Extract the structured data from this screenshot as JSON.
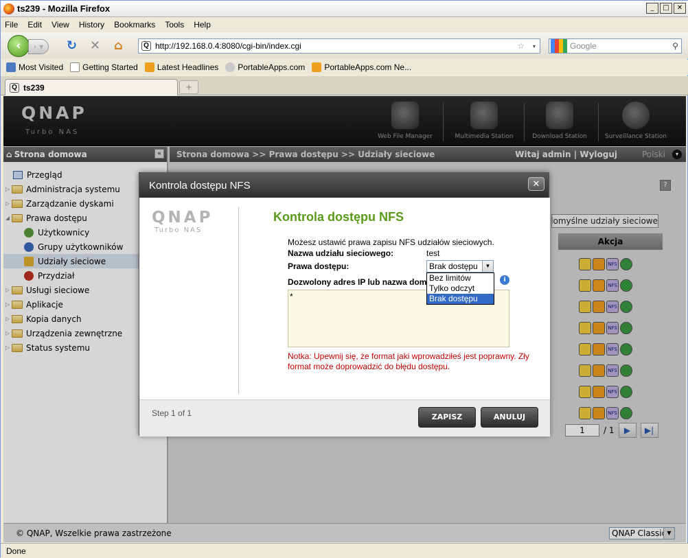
{
  "browser": {
    "title": "ts239 - Mozilla Firefox",
    "menus": [
      "File",
      "Edit",
      "View",
      "History",
      "Bookmarks",
      "Tools",
      "Help"
    ],
    "url": "http://192.168.0.4:8080/cgi-bin/index.cgi",
    "search_placeholder": "Google",
    "bookmarks": [
      "Most Visited",
      "Getting Started",
      "Latest Headlines",
      "PortableApps.com",
      "PortableApps.com Ne..."
    ],
    "tab_title": "ts239",
    "status": "Done"
  },
  "qnap": {
    "logo": "QNAP",
    "logo_sub": "Turbo NAS",
    "stations": [
      "Web File Manager",
      "Multimedia Station",
      "Download Station",
      "Surveillance Station"
    ]
  },
  "sidebar": {
    "header": "Strona domowa",
    "items": [
      {
        "label": "Przegląd"
      },
      {
        "label": "Administracja systemu"
      },
      {
        "label": "Zarządzanie dyskami"
      },
      {
        "label": "Prawa dostępu"
      },
      {
        "label": "Użytkownicy"
      },
      {
        "label": "Grupy użytkowników"
      },
      {
        "label": "Udziały sieciowe"
      },
      {
        "label": "Przydział"
      },
      {
        "label": "Usługi sieciowe"
      },
      {
        "label": "Aplikacje"
      },
      {
        "label": "Kopia danych"
      },
      {
        "label": "Urządzenia zewnętrzne"
      },
      {
        "label": "Status systemu"
      }
    ]
  },
  "main": {
    "breadcrumb": "Strona domowa >> Prawa dostępu >> Udziały sieciowe",
    "welcome": "Witaj admin | Wyloguj",
    "language": "Polski",
    "default_shares_button": "Przywróć domyślne udziały sieciowe",
    "action_header": "Akcja",
    "page_current": "1",
    "page_total": "/ 1"
  },
  "footer": {
    "copyright": "© QNAP, Wszelkie prawa zastrzeżone",
    "theme": "QNAP Classic"
  },
  "dialog": {
    "header": "Kontrola dostępu NFS",
    "title": "Kontrola dostępu NFS",
    "description": "Możesz ustawić prawa zapisu NFS udziałów sieciowych.",
    "share_label": "Nazwa udziału sieciowego:",
    "share_value": "test",
    "access_label": "Prawa dostępu:",
    "access_value": "Brak dostępu",
    "access_options": [
      "Bez limitów",
      "Tylko odczyt",
      "Brak dostępu"
    ],
    "ip_label": "Dozwolony adres IP lub nazwa domeny",
    "ip_value": "*",
    "note": "Notka: Upewnij się, że format jaki wprowadziłeś jest poprawny. Zły format może doprowadzić do błędu dostępu.",
    "step": "Step 1 of 1",
    "save": "ZAPISZ",
    "cancel": "ANULUJ"
  }
}
